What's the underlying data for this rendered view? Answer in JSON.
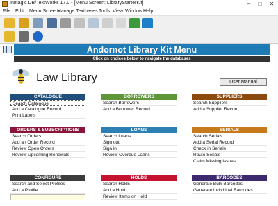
{
  "window": {
    "title": "Inmagic DB/TextWorks 17.0 - [Menu Screen: LibraryStarterKit]",
    "controls": [
      "–",
      "□",
      "✕"
    ]
  },
  "menubar": [
    "File",
    "Edit",
    "Menu Screens",
    "Manage Textbases",
    "Tools",
    "View",
    "Window",
    "Help"
  ],
  "banner": {
    "title": "Andornot Library Kit Menu",
    "subtitle": "Click on choices below to navigate the databases"
  },
  "header": {
    "library_title": "Law Library",
    "user_manual": "User Manual"
  },
  "panels": {
    "catalogue": {
      "title": "CATALOGUE",
      "color": "#1f4f7a",
      "items": [
        "Search Catalogue",
        "Add a Catalogue Record",
        "Print Labels"
      ]
    },
    "borrowers": {
      "title": "BORROWERS",
      "color": "#5f963a",
      "items": [
        "Search Borrowers",
        "Add a Borrower Record"
      ]
    },
    "suppliers": {
      "title": "SUPPLIERS",
      "color": "#8d4a0e",
      "items": [
        "Search Suppliers",
        "Add a Supplier Record"
      ]
    },
    "orders": {
      "title": "ORDERS & SUBSCRIPTIONS",
      "color": "#8a1538",
      "items": [
        "Search Orders",
        "Add an Order Record",
        "Review Open Orders",
        "Review Upcoming Renewals"
      ]
    },
    "loans": {
      "title": "LOANS",
      "color": "#2b7fb3",
      "items": [
        "Search Loans",
        "Sign out",
        "Sign in",
        "Review Overdue Loans"
      ]
    },
    "serials": {
      "title": "SERIALS",
      "color": "#c77a1b",
      "items": [
        "Search Serials",
        "Add a Serial Record",
        "Check in Serials",
        "Route Serials",
        "Claim Missing Issues"
      ]
    },
    "configure": {
      "title": "CONFIGURE",
      "color": "#3c3c3c",
      "items": [
        "Search and Select Profiles",
        "Add a Profile"
      ]
    },
    "holds": {
      "title": "HOLDS",
      "color": "#c4122f",
      "items": [
        "Search Holds",
        "Add a Hold",
        "Review Items on Hold"
      ]
    },
    "barcodes": {
      "title": "BARCODES",
      "color": "#3d2a6e",
      "items": [
        "Generate Bulk Barcodes",
        "Generate Individual Barcodes"
      ]
    }
  }
}
